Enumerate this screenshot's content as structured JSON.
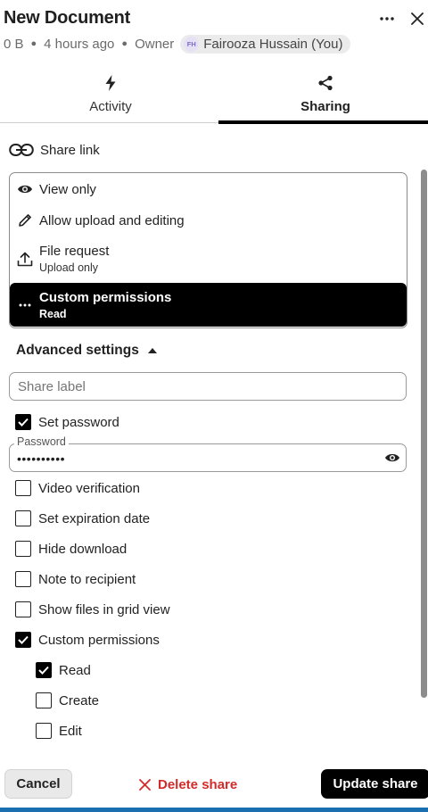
{
  "header": {
    "title": "New Document",
    "size": "0 B",
    "modified": "4 hours ago",
    "role": "Owner",
    "owner_initials": "FH",
    "owner_name": "Fairooza Hussain (You)",
    "more_icon": "more-horizontal-icon",
    "close_icon": "close-icon"
  },
  "tabs": [
    {
      "label": "Activity",
      "icon": "lightning-icon",
      "active": false
    },
    {
      "label": "Sharing",
      "icon": "share-icon",
      "active": true
    }
  ],
  "share_link": {
    "label": "Share link",
    "icon": "link-icon"
  },
  "permissions": [
    {
      "label": "View only",
      "icon": "eye-icon",
      "selected": false
    },
    {
      "label": "Allow upload and editing",
      "icon": "pencil-icon",
      "selected": false
    },
    {
      "label": "File request",
      "sublabel": "Upload only",
      "icon": "upload-icon",
      "selected": false
    },
    {
      "label": "Custom permissions",
      "sublabel": "Read",
      "icon": "more-horizontal-icon",
      "selected": true
    }
  ],
  "advanced": {
    "label": "Advanced settings",
    "expanded": true,
    "share_label_placeholder": "Share label",
    "set_password": {
      "label": "Set password",
      "checked": true
    },
    "password": {
      "label": "Password",
      "value": "••••••••••"
    },
    "video_verification": {
      "label": "Video verification",
      "checked": false
    },
    "expiration": {
      "label": "Set expiration date",
      "checked": false
    },
    "hide_download": {
      "label": "Hide download",
      "checked": false
    },
    "note": {
      "label": "Note to recipient",
      "checked": false
    },
    "grid_view": {
      "label": "Show files in grid view",
      "checked": false
    },
    "custom_permissions": {
      "label": "Custom permissions",
      "checked": true
    },
    "sub_permissions": [
      {
        "label": "Read",
        "checked": true
      },
      {
        "label": "Create",
        "checked": false
      },
      {
        "label": "Edit",
        "checked": false
      }
    ]
  },
  "footer": {
    "cancel": "Cancel",
    "delete": "Delete share",
    "update": "Update share"
  },
  "colors": {
    "accent": "#000000",
    "danger": "#d52a2a",
    "bottom_bar": "#1a6fb0"
  }
}
